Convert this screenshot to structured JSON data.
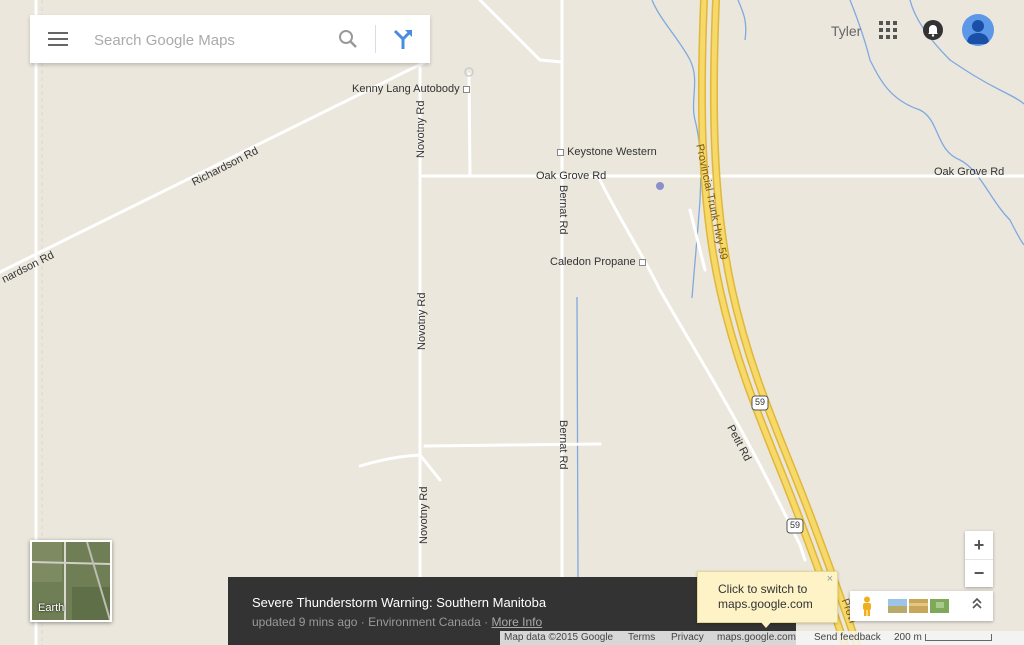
{
  "search": {
    "placeholder": "Search Google Maps"
  },
  "user": {
    "name": "Tyler"
  },
  "map": {
    "road_labels": {
      "richardson_rd_1": "Richardson Rd",
      "richardson_rd_2": "nardson Rd",
      "novotny_rd_1": "Novotny Rd",
      "novotny_rd_2": "Novotny Rd",
      "novotny_rd_3": "Novotny Rd",
      "bernat_rd_1": "Bernat Rd",
      "bernat_rd_2": "Bernat Rd",
      "oak_grove_rd_1": "Oak Grove Rd",
      "oak_grove_rd_2": "Oak Grove Rd",
      "highway_59": "Provincial Trunk Hwy 59",
      "highway_59_b": "Provi",
      "petit_rd": "Petit Rd",
      "shield_59_a": "59",
      "shield_59_b": "59"
    },
    "places": [
      {
        "name": "Kenny Lang Autobody"
      },
      {
        "name": "Keystone Western"
      },
      {
        "name": "Caledon Propane"
      }
    ]
  },
  "earth": {
    "label": "Earth"
  },
  "alert": {
    "title": "Severe Thunderstorm Warning: Southern Manitoba",
    "updated": "updated 9 mins ago · Environment Canada · ",
    "more_info": "More Info"
  },
  "tooltip": {
    "text": "Click to switch to maps.google.com",
    "close": "×"
  },
  "zoom": {
    "in": "+",
    "out": "−"
  },
  "footer": {
    "map_data": "Map data ©2015 Google",
    "terms": "Terms",
    "privacy": "Privacy",
    "site": "maps.google.com",
    "feedback": "Send feedback",
    "scale": "200 m"
  },
  "colors": {
    "background": "#ebe7dd",
    "road": "#ffffff",
    "highway": "#f3cf45",
    "water": "#7fa9e0",
    "alert_bg": "#333333",
    "tooltip_bg": "#fdf3c6"
  }
}
